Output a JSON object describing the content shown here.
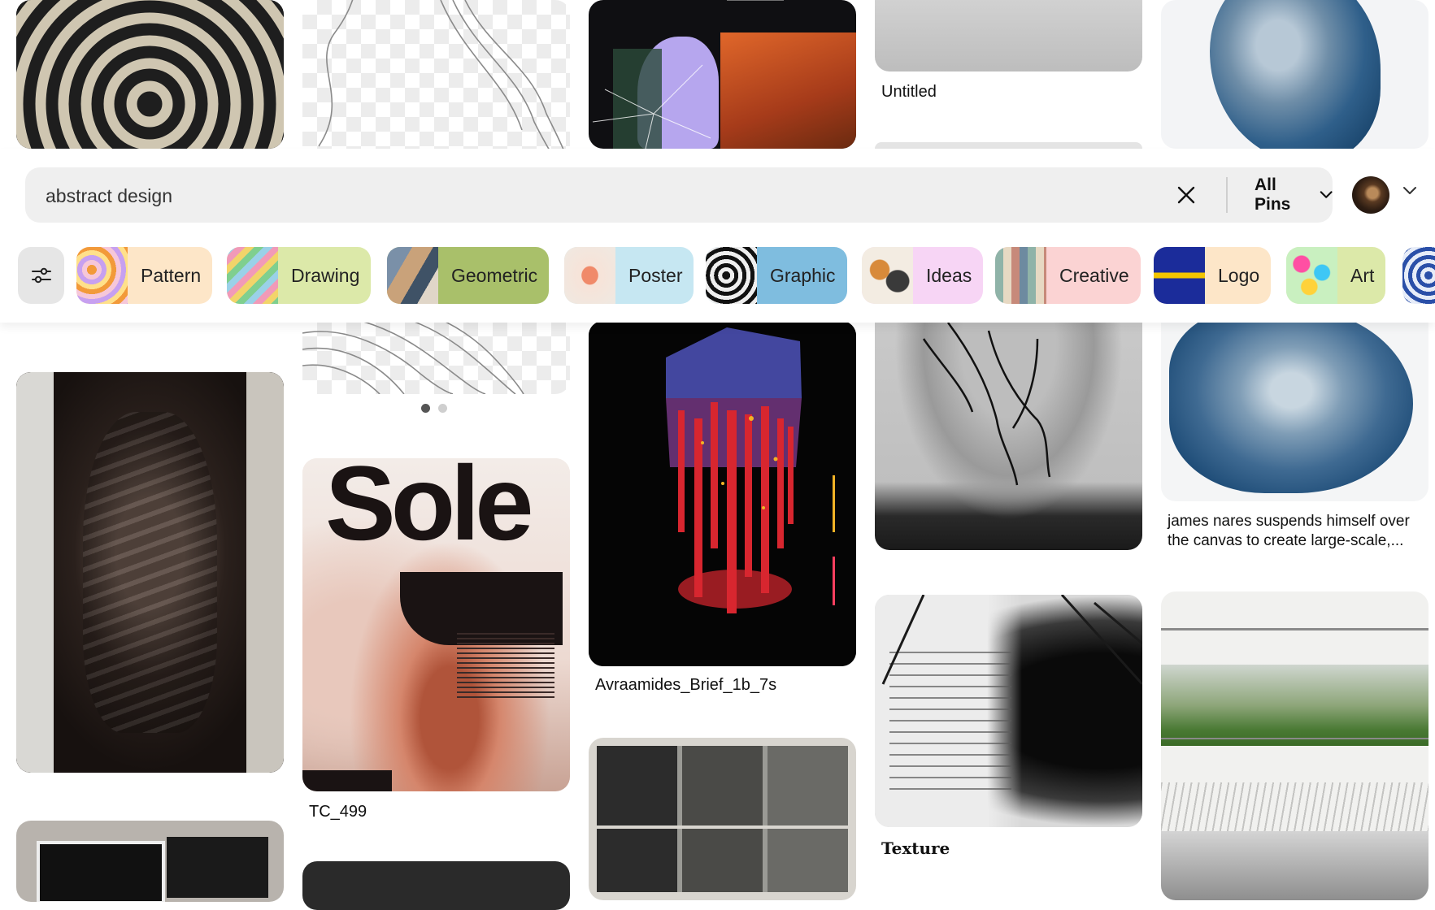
{
  "search": {
    "query": "abstract design",
    "scope_label": "All Pins"
  },
  "chips": [
    {
      "label": "Pattern",
      "bg": "#fde6c8"
    },
    {
      "label": "Drawing",
      "bg": "#dce9a9"
    },
    {
      "label": "Geometric",
      "bg": "#a9c06a"
    },
    {
      "label": "Poster",
      "bg": "#c6e7f2"
    },
    {
      "label": "Graphic",
      "bg": "#7fbddf"
    },
    {
      "label": "Ideas",
      "bg": "#f7d5f5"
    },
    {
      "label": "Creative",
      "bg": "#fbd3d3"
    },
    {
      "label": "Logo",
      "bg": "#fde6c8"
    },
    {
      "label": "Art",
      "bg": "#dce9a9"
    }
  ],
  "pins": {
    "col4_top_caption": "Untitled",
    "col3_caption": "Avraamides_Brief_1b_7s",
    "col2_caption": "TC_499",
    "col2_poster_text": "Sole",
    "col4_bottom_caption": "Texture",
    "col5_caption": "james nares suspends himself over the canvas to create large-scale,..."
  }
}
